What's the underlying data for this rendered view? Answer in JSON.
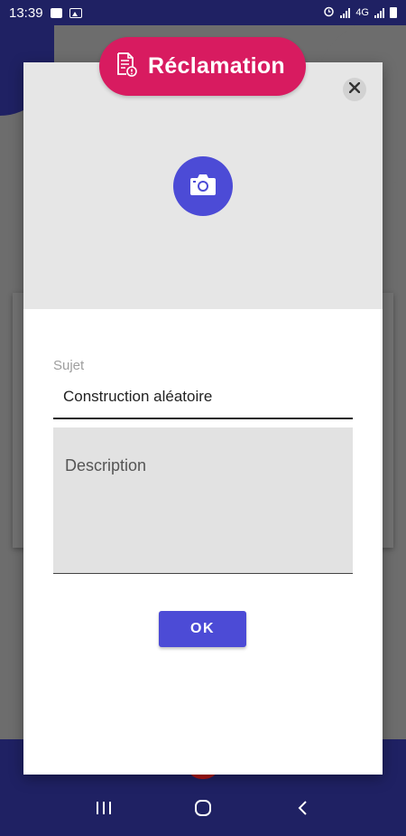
{
  "status_bar": {
    "time": "13:39",
    "network": "4G",
    "icons": [
      "check-box-icon",
      "image-icon",
      "alarm-icon",
      "signal-icon",
      "battery-icon"
    ]
  },
  "dialog": {
    "title": "Réclamation",
    "title_icon": "document-alert-icon",
    "camera_icon": "camera-icon",
    "close_icon": "close-icon",
    "subject": {
      "label": "Sujet",
      "value": "Construction aléatoire"
    },
    "description": {
      "placeholder": "Description"
    },
    "ok_label": "OK"
  },
  "nav_bar": {
    "icons": [
      "recent-apps-icon",
      "home-icon",
      "back-icon"
    ]
  },
  "colors": {
    "primary_dark": "#1f2163",
    "accent_pink": "#d81b60",
    "button_blue": "#4c4bd6"
  }
}
